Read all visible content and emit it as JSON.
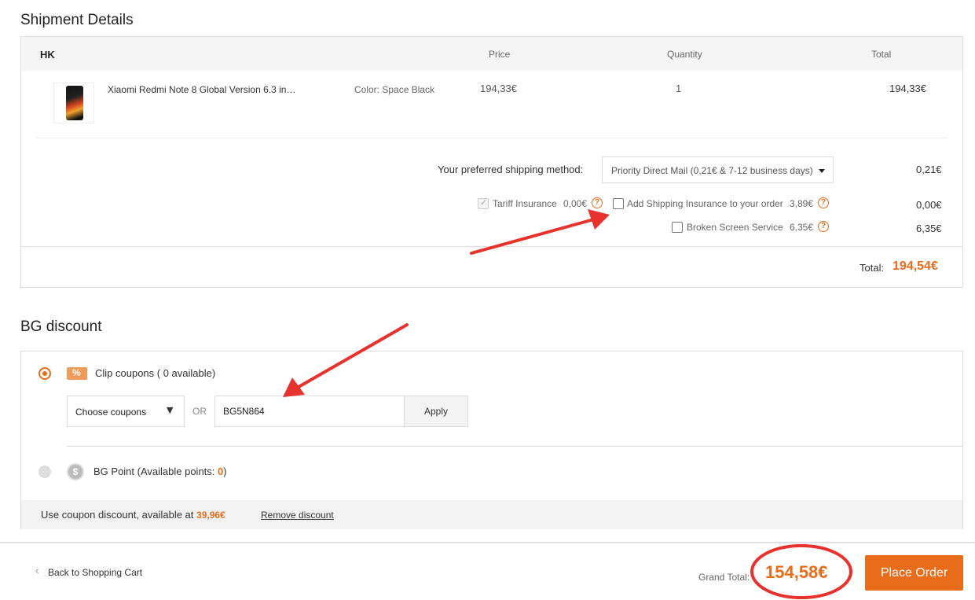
{
  "shipment": {
    "section_title": "Shipment Details",
    "warehouse": "HK",
    "col_price": "Price",
    "col_quantity": "Quantity",
    "col_total": "Total",
    "product": {
      "name": "Xiaomi Redmi Note 8 Global Version 6.3 in…",
      "color": "Color: Space Black",
      "price": "194,33€",
      "quantity": "1",
      "total": "194,33€"
    },
    "shipping_label": "Your preferred shipping method:",
    "shipping_selected": "Priority Direct Mail (0,21€ & 7-12 business days)",
    "shipping_cost": "0,21€",
    "tariff_label": "Tariff Insurance",
    "tariff_price": "0,00€",
    "shipping_insurance_label": "Add Shipping Insurance to your order",
    "shipping_insurance_price": "3,89€",
    "shipping_insurance_cost": "0,00€",
    "broken_screen_label": "Broken Screen Service",
    "broken_screen_price": "6,35€",
    "broken_screen_cost": "6,35€",
    "total_label": "Total:",
    "total_value": "194,54€"
  },
  "discount": {
    "section_title": "BG discount",
    "clip_coupons_label": "Clip coupons ( 0 available)",
    "choose_coupons": "Choose coupons",
    "or_label": "OR",
    "coupon_code": "BG5N864",
    "apply_label": "Apply",
    "bg_point_label": "BG Point (Available points: ",
    "bg_point_value": "0",
    "bg_point_suffix": ")",
    "use_coupon_text": "Use coupon discount, available at ",
    "use_coupon_amount": "39,96€",
    "remove_discount": "Remove discount"
  },
  "footer": {
    "back_label": "Back to Shopping Cart",
    "grand_total_label": "Grand Total:",
    "grand_total_value": "154,58€",
    "place_order": "Place Order"
  },
  "colors": {
    "accent": "#e86c1a",
    "annotation": "#e8322e"
  },
  "icons": [
    "question-icon",
    "coupon-icon",
    "point-coin-icon",
    "chevron-left-icon",
    "caret-down-icon",
    "check-icon"
  ]
}
